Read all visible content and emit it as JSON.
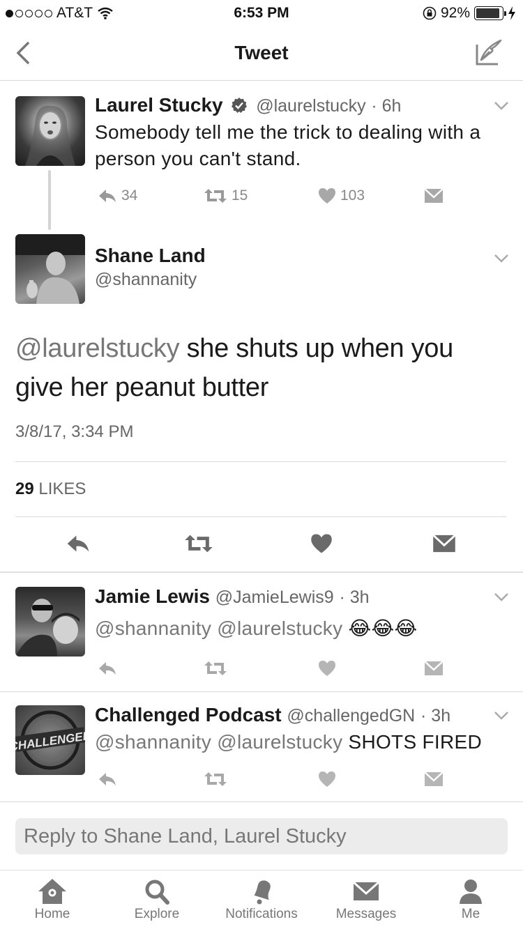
{
  "status_bar": {
    "carrier": "AT&T",
    "time": "6:53 PM",
    "battery_percent": "92%",
    "battery_level": 0.92
  },
  "nav": {
    "title": "Tweet"
  },
  "parent_tweet": {
    "name": "Laurel Stucky",
    "handle": "@laurelstucky",
    "age": "· 6h",
    "text": "Somebody tell me the trick to dealing with a person you can't stand.",
    "replies": "34",
    "retweets": "15",
    "likes": "103"
  },
  "main_tweet": {
    "name": "Shane Land",
    "handle": "@shannanity",
    "mention": "@laurelstucky",
    "text": " she shuts up when you give her peanut butter",
    "timestamp": "3/8/17, 3:34 PM",
    "likes_count": "29",
    "likes_label": "LIKES"
  },
  "replies": [
    {
      "name": "Jamie Lewis",
      "handle": "@JamieLewis9",
      "age": "· 3h",
      "mentions": "@shannanity @laurelstucky",
      "text": " 😂😂😂"
    },
    {
      "name": "Challenged Podcast",
      "handle": "@challengedGN",
      "age": "· 3h",
      "mentions": "@shannanity @laurelstucky",
      "text": " SHOTS FIRED",
      "avatar_text": "CHALLENGED"
    }
  ],
  "reply_box": {
    "placeholder": "Reply to Shane Land, Laurel Stucky"
  },
  "tabs": [
    {
      "label": "Home",
      "icon": "home-icon"
    },
    {
      "label": "Explore",
      "icon": "search-icon"
    },
    {
      "label": "Notifications",
      "icon": "bell-icon"
    },
    {
      "label": "Messages",
      "icon": "envelope-icon"
    },
    {
      "label": "Me",
      "icon": "person-icon"
    }
  ]
}
